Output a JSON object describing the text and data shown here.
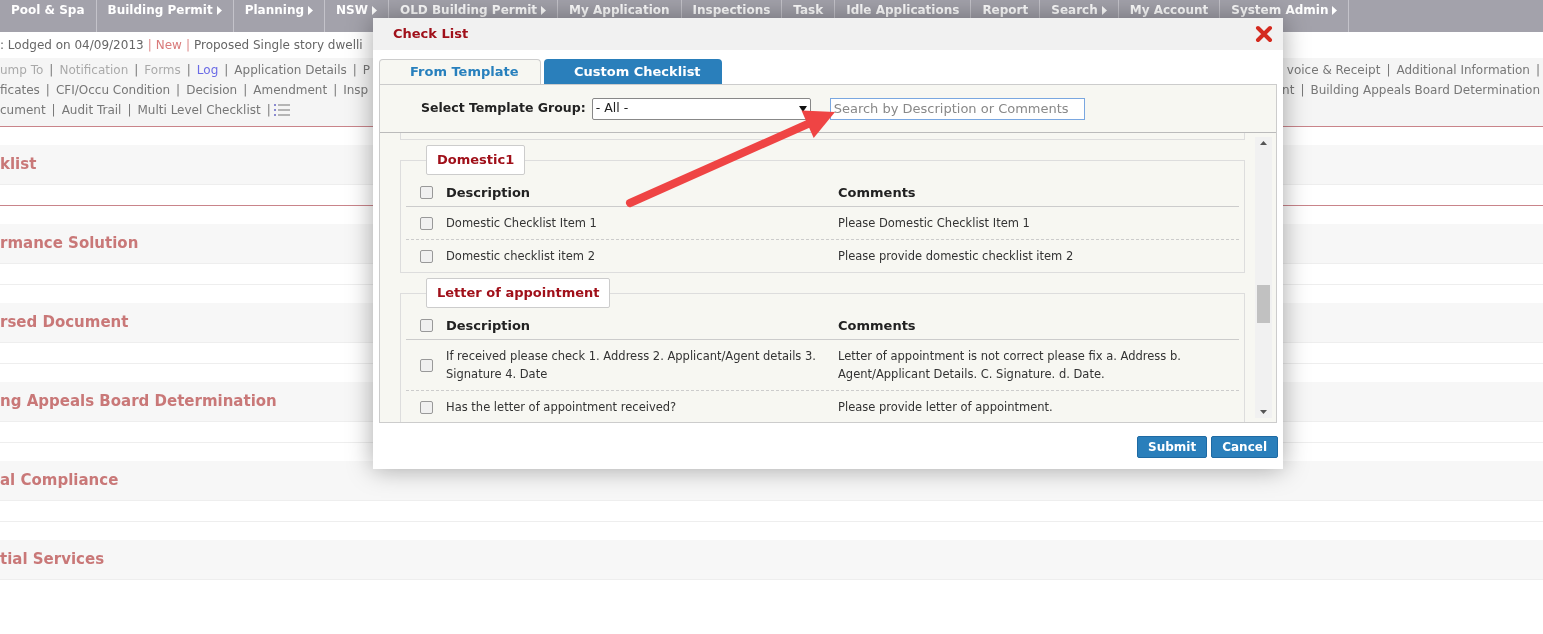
{
  "nav": [
    {
      "label": "Pool & Spa",
      "submenu": false
    },
    {
      "label": "Building Permit",
      "submenu": true
    },
    {
      "label": "Planning",
      "submenu": true
    },
    {
      "label": "NSW",
      "submenu": true
    },
    {
      "label": "OLD Building Permit",
      "submenu": true
    },
    {
      "label": "My Application",
      "submenu": false
    },
    {
      "label": "Inspections",
      "submenu": false
    },
    {
      "label": "Task",
      "submenu": false
    },
    {
      "label": "Idle Applications",
      "submenu": false
    },
    {
      "label": "Report",
      "submenu": false
    },
    {
      "label": "Search",
      "submenu": true
    },
    {
      "label": "My Account",
      "submenu": false
    },
    {
      "label": "System Admin",
      "submenu": true
    }
  ],
  "summary": {
    "lodged": ": Lodged on 04/09/2013",
    "status": "New",
    "description": "Proposed Single story dwelli"
  },
  "separator": "|",
  "link_rows": [
    {
      "left": [
        {
          "label": "ump To",
          "disabled": true,
          "selected": false
        },
        {
          "label": "Notification",
          "disabled": true,
          "selected": false
        },
        {
          "label": "Forms",
          "disabled": true,
          "selected": false
        },
        {
          "label": "Log",
          "disabled": false,
          "selected": true
        },
        {
          "label": "Application Details",
          "disabled": false,
          "selected": false
        },
        {
          "label": "P",
          "disabled": false,
          "selected": false
        }
      ],
      "right": [
        {
          "label": "voice & Receipt",
          "disabled": false,
          "selected": false
        },
        {
          "label": "Additional Information",
          "disabled": false,
          "selected": false
        }
      ],
      "trailing_separator": true,
      "menu_icon": false
    },
    {
      "left": [
        {
          "label": "ficates",
          "disabled": false,
          "selected": false
        },
        {
          "label": "CFI/Occu Condition",
          "disabled": false,
          "selected": false
        },
        {
          "label": "Decision",
          "disabled": false,
          "selected": false
        },
        {
          "label": "Amendment",
          "disabled": false,
          "selected": false
        },
        {
          "label": "Insp",
          "disabled": false,
          "selected": false
        }
      ],
      "right": [
        {
          "label": "nt",
          "disabled": false,
          "selected": false
        },
        {
          "label": "Building Appeals Board Determination",
          "disabled": false,
          "selected": false
        }
      ],
      "trailing_separator": false,
      "menu_icon": false
    },
    {
      "left": [
        {
          "label": "cument",
          "disabled": false,
          "selected": false
        },
        {
          "label": "Audit Trail",
          "disabled": false,
          "selected": false
        },
        {
          "label": "Multi Level Checklist",
          "disabled": false,
          "selected": false
        }
      ],
      "right": [],
      "trailing_separator": true,
      "menu_icon": true
    }
  ],
  "sections": [
    {
      "title": "klist",
      "ruled": true
    },
    {
      "title": "rmance Solution",
      "ruled": true
    },
    {
      "title": "rsed Document",
      "ruled": false
    },
    {
      "title": "ng Appeals Board Determination",
      "ruled": false
    },
    {
      "title": "al Compliance",
      "ruled": false
    },
    {
      "title": "tial Services",
      "ruled": false
    }
  ],
  "dialog": {
    "title": "Check List",
    "tabs": [
      {
        "label": "From Template",
        "selected": true
      },
      {
        "label": "Custom Checklist",
        "selected": false
      }
    ],
    "template_group": {
      "label": "Select Template Group:",
      "value": "- All -"
    },
    "search": {
      "placeholder": "Search by Description or Comments"
    },
    "groups": [
      {
        "name": "Domestic1",
        "columns": [
          "Description",
          "Comments"
        ],
        "all_checked": false,
        "rows": [
          {
            "description": "Domestic Checklist Item 1",
            "comments": "Please Domestic Checklist Item 1",
            "checked": false
          },
          {
            "description": "Domestic checklist item 2",
            "comments": "Please provide domestic checklist item 2",
            "checked": false
          }
        ]
      },
      {
        "name": "Letter of appointment",
        "columns": [
          "Description",
          "Comments"
        ],
        "all_checked": false,
        "rows": [
          {
            "description": "If received please check 1. Address 2. Applicant/Agent details 3. Signature 4. Date",
            "comments": "Letter of appointment is not correct please fix a. Address b. Agent/Applicant Details. C. Signature. d. Date.",
            "checked": false
          },
          {
            "description": "Has the letter of appointment received?",
            "comments": "Please provide letter of appointment.",
            "checked": false
          }
        ]
      }
    ],
    "buttons": [
      "Submit",
      "Cancel"
    ]
  }
}
